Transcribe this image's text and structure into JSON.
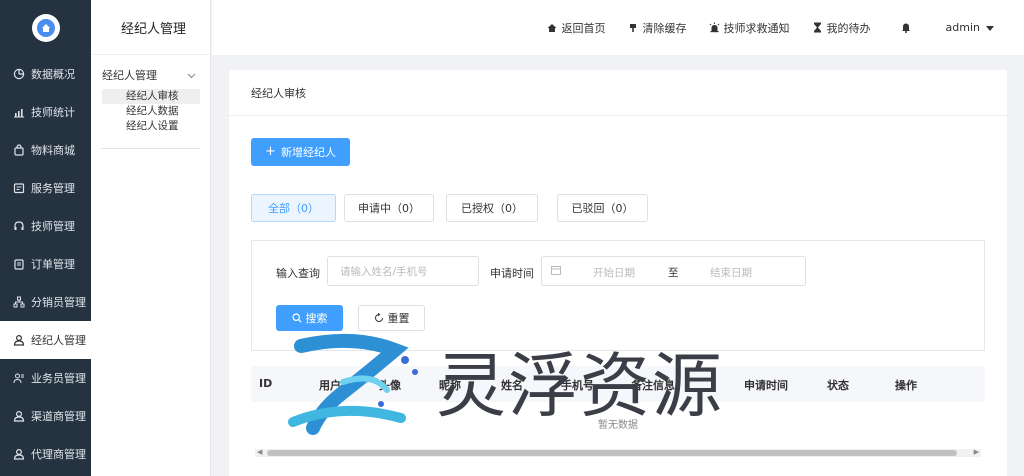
{
  "sidebar": {
    "items": [
      {
        "label": "数据概况",
        "icon": "pie-chart-icon"
      },
      {
        "label": "技师统计",
        "icon": "bar-stats-icon"
      },
      {
        "label": "物料商城",
        "icon": "shopping-bag-icon"
      },
      {
        "label": "服务管理",
        "icon": "service-icon"
      },
      {
        "label": "技师管理",
        "icon": "headset-icon"
      },
      {
        "label": "订单管理",
        "icon": "clipboard-icon"
      },
      {
        "label": "分销员管理",
        "icon": "org-chart-icon"
      },
      {
        "label": "经纪人管理",
        "icon": "user-icon"
      },
      {
        "label": "业务员管理",
        "icon": "user-group-icon"
      },
      {
        "label": "渠道商管理",
        "icon": "user-badge-icon"
      },
      {
        "label": "代理商管理",
        "icon": "user-star-icon"
      }
    ],
    "active_index": 7
  },
  "subbar": {
    "title": "经纪人管理",
    "group_label": "经纪人管理",
    "items": [
      "经纪人审核",
      "经纪人数据",
      "经纪人设置"
    ]
  },
  "header": {
    "home": "返回首页",
    "clear_cache": "清除缓存",
    "rescue_notice": "技师求救通知",
    "todo": "我的待办",
    "user": "admin"
  },
  "card": {
    "title": "经纪人审核",
    "add_button": "新增经纪人",
    "tabs": [
      "全部（0）",
      "申请中（0）",
      "已授权（0）",
      "已驳回（0）"
    ],
    "filter": {
      "query_label": "输入查询",
      "query_placeholder": "请输入姓名/手机号",
      "time_label": "申请时间",
      "start_placeholder": "开始日期",
      "range_sep": "至",
      "end_placeholder": "结束日期",
      "search_button": "搜索",
      "reset_button": "重置"
    },
    "table": {
      "columns": [
        "ID",
        "用户",
        "头像",
        "昵称",
        "姓名",
        "手机号",
        "备注信息",
        "申请时间",
        "状态",
        "操作"
      ],
      "empty_text": "暂无数据"
    }
  },
  "watermark": {
    "text": "灵浮资源"
  },
  "colors": {
    "primary": "#409eff",
    "sidebar_bg": "#253240"
  }
}
